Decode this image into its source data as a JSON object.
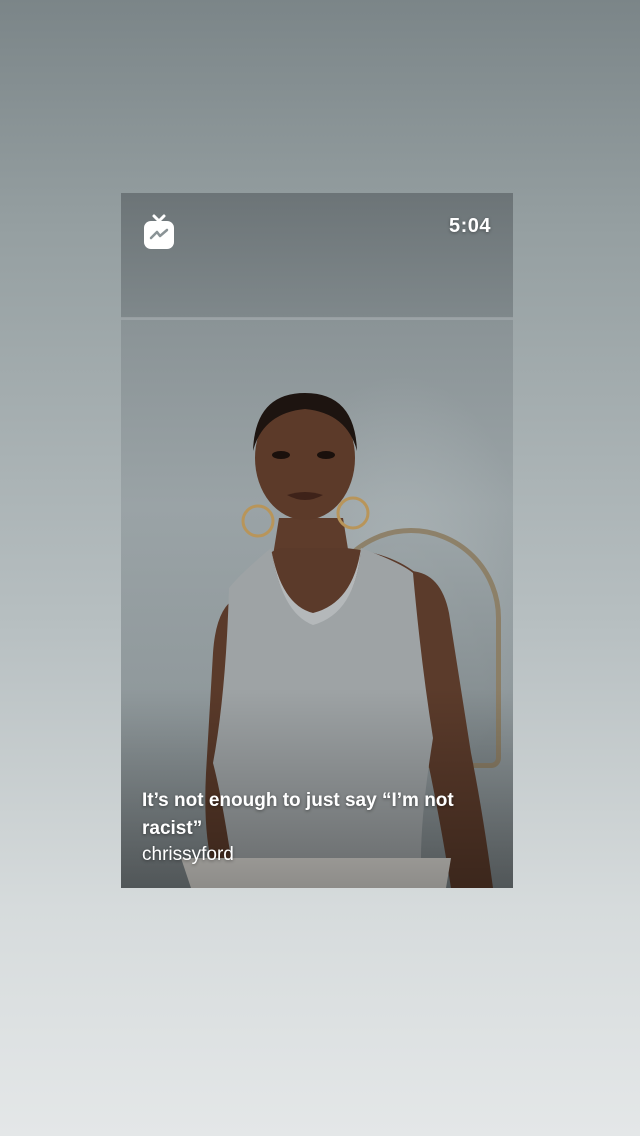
{
  "video": {
    "time_remaining": "5:04",
    "caption": "It’s not enough to just say “I’m not racist”",
    "username": "chrissyford"
  },
  "icons": {
    "top_left": "igtv-icon"
  },
  "colors": {
    "overlay_text": "#ffffff",
    "background_top": "#7b8588",
    "background_bottom": "#e4e7e8"
  }
}
